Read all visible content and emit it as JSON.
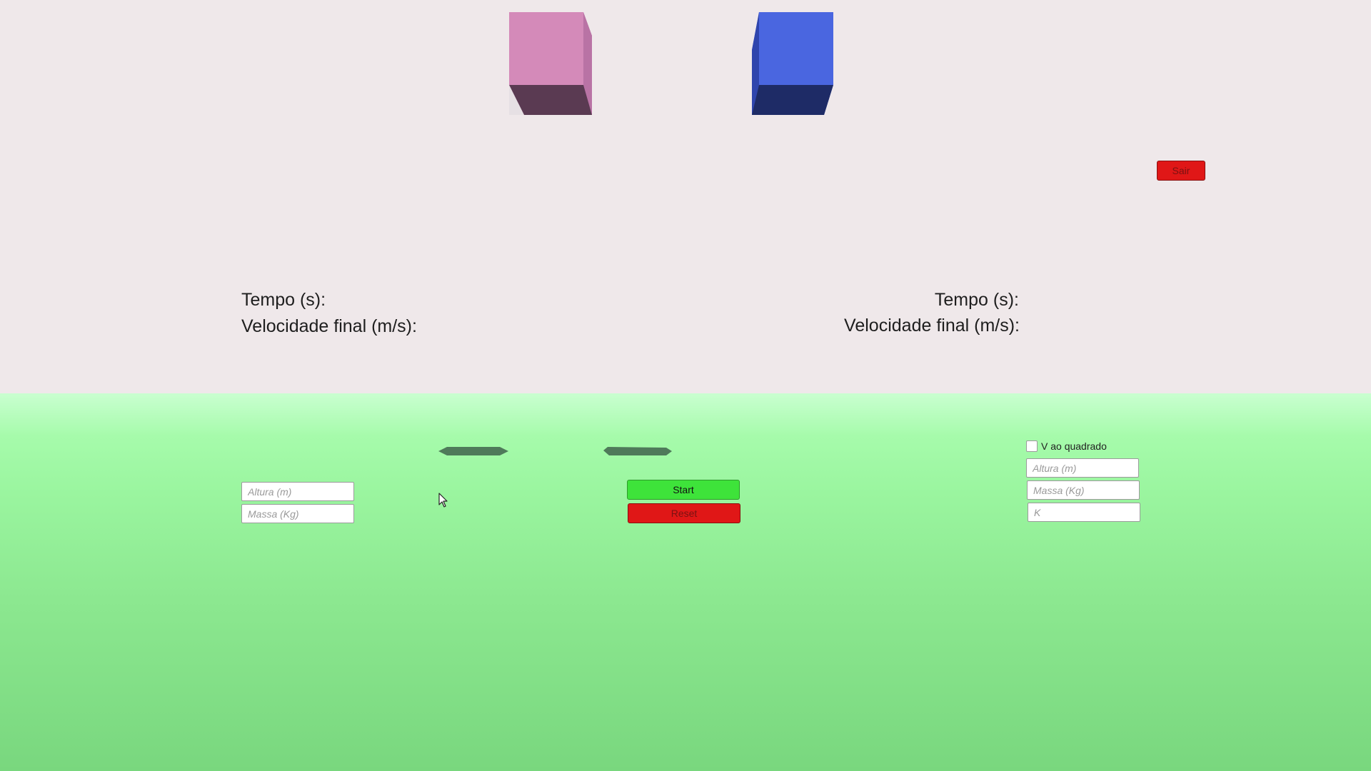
{
  "scene": {
    "colors": {
      "sky": "#efe8ea",
      "ground": "#8be78f",
      "pink_cube": "#d488b8",
      "blue_cube": "#4a66e0",
      "start_button": "#3ee33a",
      "red_buttons": "#e01717"
    }
  },
  "left_panel": {
    "tempo_label": "Tempo (s):",
    "velocidade_label": "Velocidade final (m/s):",
    "altura_placeholder": "Altura (m)",
    "massa_placeholder": "Massa (Kg)"
  },
  "right_panel": {
    "tempo_label": "Tempo (s):",
    "velocidade_label": "Velocidade final (m/s):",
    "checkbox_label": "V ao quadrado",
    "checkbox_checked": false,
    "altura_placeholder": "Altura (m)",
    "massa_placeholder": "Massa (Kg)",
    "k_placeholder": "K"
  },
  "controls": {
    "start_label": "Start",
    "reset_label": "Reset",
    "sair_label": "Sair"
  },
  "icons": {
    "cursor": "mouse-pointer-icon"
  }
}
